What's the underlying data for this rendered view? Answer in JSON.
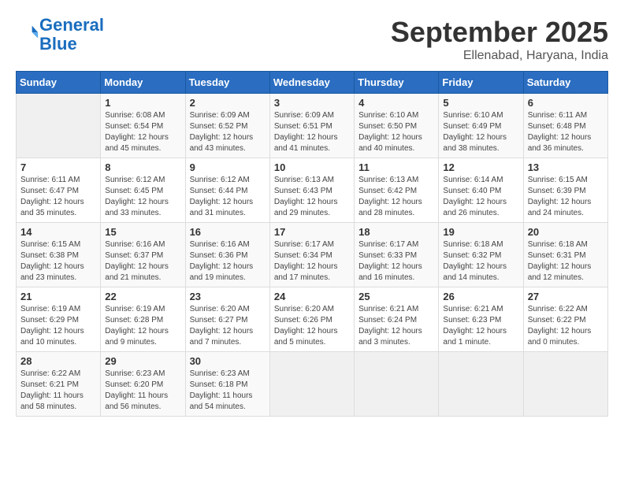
{
  "logo": {
    "line1": "General",
    "line2": "Blue"
  },
  "header": {
    "month": "September 2025",
    "location": "Ellenabad, Haryana, India"
  },
  "weekdays": [
    "Sunday",
    "Monday",
    "Tuesday",
    "Wednesday",
    "Thursday",
    "Friday",
    "Saturday"
  ],
  "weeks": [
    [
      {
        "day": "",
        "info": ""
      },
      {
        "day": "1",
        "info": "Sunrise: 6:08 AM\nSunset: 6:54 PM\nDaylight: 12 hours\nand 45 minutes."
      },
      {
        "day": "2",
        "info": "Sunrise: 6:09 AM\nSunset: 6:52 PM\nDaylight: 12 hours\nand 43 minutes."
      },
      {
        "day": "3",
        "info": "Sunrise: 6:09 AM\nSunset: 6:51 PM\nDaylight: 12 hours\nand 41 minutes."
      },
      {
        "day": "4",
        "info": "Sunrise: 6:10 AM\nSunset: 6:50 PM\nDaylight: 12 hours\nand 40 minutes."
      },
      {
        "day": "5",
        "info": "Sunrise: 6:10 AM\nSunset: 6:49 PM\nDaylight: 12 hours\nand 38 minutes."
      },
      {
        "day": "6",
        "info": "Sunrise: 6:11 AM\nSunset: 6:48 PM\nDaylight: 12 hours\nand 36 minutes."
      }
    ],
    [
      {
        "day": "7",
        "info": "Sunrise: 6:11 AM\nSunset: 6:47 PM\nDaylight: 12 hours\nand 35 minutes."
      },
      {
        "day": "8",
        "info": "Sunrise: 6:12 AM\nSunset: 6:45 PM\nDaylight: 12 hours\nand 33 minutes."
      },
      {
        "day": "9",
        "info": "Sunrise: 6:12 AM\nSunset: 6:44 PM\nDaylight: 12 hours\nand 31 minutes."
      },
      {
        "day": "10",
        "info": "Sunrise: 6:13 AM\nSunset: 6:43 PM\nDaylight: 12 hours\nand 29 minutes."
      },
      {
        "day": "11",
        "info": "Sunrise: 6:13 AM\nSunset: 6:42 PM\nDaylight: 12 hours\nand 28 minutes."
      },
      {
        "day": "12",
        "info": "Sunrise: 6:14 AM\nSunset: 6:40 PM\nDaylight: 12 hours\nand 26 minutes."
      },
      {
        "day": "13",
        "info": "Sunrise: 6:15 AM\nSunset: 6:39 PM\nDaylight: 12 hours\nand 24 minutes."
      }
    ],
    [
      {
        "day": "14",
        "info": "Sunrise: 6:15 AM\nSunset: 6:38 PM\nDaylight: 12 hours\nand 23 minutes."
      },
      {
        "day": "15",
        "info": "Sunrise: 6:16 AM\nSunset: 6:37 PM\nDaylight: 12 hours\nand 21 minutes."
      },
      {
        "day": "16",
        "info": "Sunrise: 6:16 AM\nSunset: 6:36 PM\nDaylight: 12 hours\nand 19 minutes."
      },
      {
        "day": "17",
        "info": "Sunrise: 6:17 AM\nSunset: 6:34 PM\nDaylight: 12 hours\nand 17 minutes."
      },
      {
        "day": "18",
        "info": "Sunrise: 6:17 AM\nSunset: 6:33 PM\nDaylight: 12 hours\nand 16 minutes."
      },
      {
        "day": "19",
        "info": "Sunrise: 6:18 AM\nSunset: 6:32 PM\nDaylight: 12 hours\nand 14 minutes."
      },
      {
        "day": "20",
        "info": "Sunrise: 6:18 AM\nSunset: 6:31 PM\nDaylight: 12 hours\nand 12 minutes."
      }
    ],
    [
      {
        "day": "21",
        "info": "Sunrise: 6:19 AM\nSunset: 6:29 PM\nDaylight: 12 hours\nand 10 minutes."
      },
      {
        "day": "22",
        "info": "Sunrise: 6:19 AM\nSunset: 6:28 PM\nDaylight: 12 hours\nand 9 minutes."
      },
      {
        "day": "23",
        "info": "Sunrise: 6:20 AM\nSunset: 6:27 PM\nDaylight: 12 hours\nand 7 minutes."
      },
      {
        "day": "24",
        "info": "Sunrise: 6:20 AM\nSunset: 6:26 PM\nDaylight: 12 hours\nand 5 minutes."
      },
      {
        "day": "25",
        "info": "Sunrise: 6:21 AM\nSunset: 6:24 PM\nDaylight: 12 hours\nand 3 minutes."
      },
      {
        "day": "26",
        "info": "Sunrise: 6:21 AM\nSunset: 6:23 PM\nDaylight: 12 hours\nand 1 minute."
      },
      {
        "day": "27",
        "info": "Sunrise: 6:22 AM\nSunset: 6:22 PM\nDaylight: 12 hours\nand 0 minutes."
      }
    ],
    [
      {
        "day": "28",
        "info": "Sunrise: 6:22 AM\nSunset: 6:21 PM\nDaylight: 11 hours\nand 58 minutes."
      },
      {
        "day": "29",
        "info": "Sunrise: 6:23 AM\nSunset: 6:20 PM\nDaylight: 11 hours\nand 56 minutes."
      },
      {
        "day": "30",
        "info": "Sunrise: 6:23 AM\nSunset: 6:18 PM\nDaylight: 11 hours\nand 54 minutes."
      },
      {
        "day": "",
        "info": ""
      },
      {
        "day": "",
        "info": ""
      },
      {
        "day": "",
        "info": ""
      },
      {
        "day": "",
        "info": ""
      }
    ]
  ]
}
